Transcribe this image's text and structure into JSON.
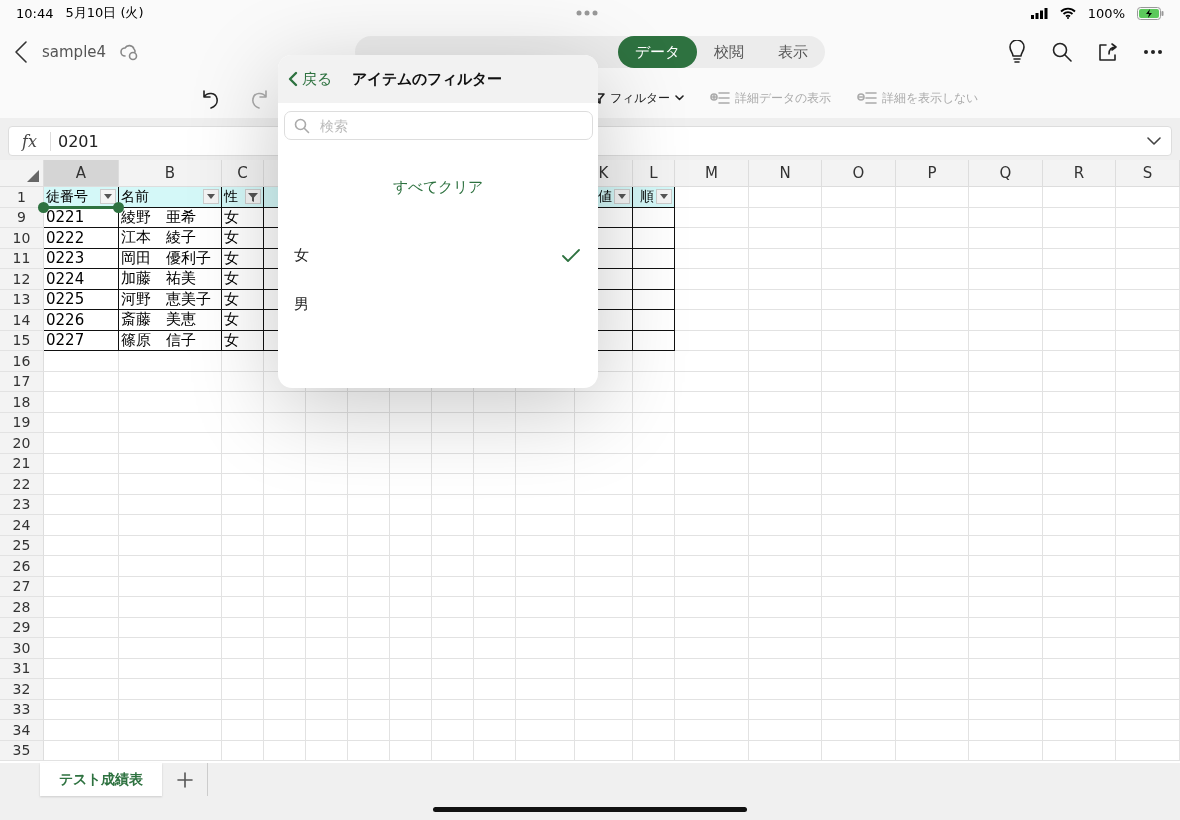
{
  "status_bar": {
    "time": "10:44",
    "date": "5月10日 (火)",
    "battery": "100%"
  },
  "app_bar": {
    "file_name": "sample4",
    "tabs": [
      {
        "label": "データ",
        "selected": true
      },
      {
        "label": "校閲",
        "selected": false
      },
      {
        "label": "表示",
        "selected": false
      }
    ]
  },
  "toolbar": {
    "left": [
      {
        "kind": "undo",
        "disabled": false
      },
      {
        "kind": "redo",
        "disabled": true
      }
    ],
    "right": [
      {
        "kind": "filter",
        "label": "フィルター",
        "disabled": false
      },
      {
        "kind": "show-detail",
        "label": "詳細データの表示",
        "disabled": true
      },
      {
        "kind": "hide-detail",
        "label": "詳細を表示しない",
        "disabled": true
      }
    ]
  },
  "formula_bar": {
    "label": "fx",
    "value": "0201"
  },
  "sheet": {
    "column_headers": [
      {
        "label": "A",
        "selected": true
      },
      {
        "label": "B",
        "selected": false
      },
      {
        "label": "C",
        "selected": false
      },
      {
        "label": "K",
        "selected": false
      },
      {
        "label": "L",
        "selected": false
      },
      {
        "label": "M",
        "selected": false
      },
      {
        "label": "N",
        "selected": false
      },
      {
        "label": "O",
        "selected": false
      },
      {
        "label": "P",
        "selected": false
      },
      {
        "label": "Q",
        "selected": false
      },
      {
        "label": "R",
        "selected": false
      },
      {
        "label": "S",
        "selected": false
      }
    ],
    "header_row": {
      "number": "1",
      "left": [
        {
          "text": "徒番号",
          "filtered": false
        },
        {
          "text": "名前",
          "filtered": false
        },
        {
          "text": "性",
          "filtered": true
        }
      ],
      "right": [
        {
          "text": "値",
          "filtered": false
        },
        {
          "text": "順",
          "filtered": false
        }
      ]
    },
    "rows": [
      {
        "number": "9",
        "cells": [
          "0221",
          "綾野　亜希",
          "女"
        ]
      },
      {
        "number": "10",
        "cells": [
          "0222",
          "江本　綾子",
          "女"
        ]
      },
      {
        "number": "11",
        "cells": [
          "0223",
          "岡田　優利子",
          "女"
        ]
      },
      {
        "number": "12",
        "cells": [
          "0224",
          "加藤　祐美",
          "女"
        ]
      },
      {
        "number": "13",
        "cells": [
          "0225",
          "河野　恵美子",
          "女"
        ]
      },
      {
        "number": "14",
        "cells": [
          "0226",
          "斎藤　美恵",
          "女"
        ]
      },
      {
        "number": "15",
        "cells": [
          "0227",
          "篠原　信子",
          "女"
        ]
      },
      {
        "number": "16"
      },
      {
        "number": "17"
      },
      {
        "number": "18"
      },
      {
        "number": "19"
      },
      {
        "number": "20"
      },
      {
        "number": "21"
      },
      {
        "number": "22"
      },
      {
        "number": "23"
      },
      {
        "number": "24"
      },
      {
        "number": "25"
      },
      {
        "number": "26"
      },
      {
        "number": "27"
      },
      {
        "number": "28"
      },
      {
        "number": "29"
      },
      {
        "number": "30"
      },
      {
        "number": "31"
      },
      {
        "number": "32"
      },
      {
        "number": "33"
      },
      {
        "number": "34"
      },
      {
        "number": "35"
      }
    ]
  },
  "filter_popover": {
    "back": "戻る",
    "title": "アイテムのフィルター",
    "search": {
      "placeholder": "検索"
    },
    "clear_all": "すべてクリア",
    "items": [
      {
        "label": "女",
        "checked": true
      },
      {
        "label": "男",
        "checked": false
      }
    ]
  },
  "sheet_tabs": [
    {
      "label": "テスト成績表",
      "selected": true
    }
  ]
}
